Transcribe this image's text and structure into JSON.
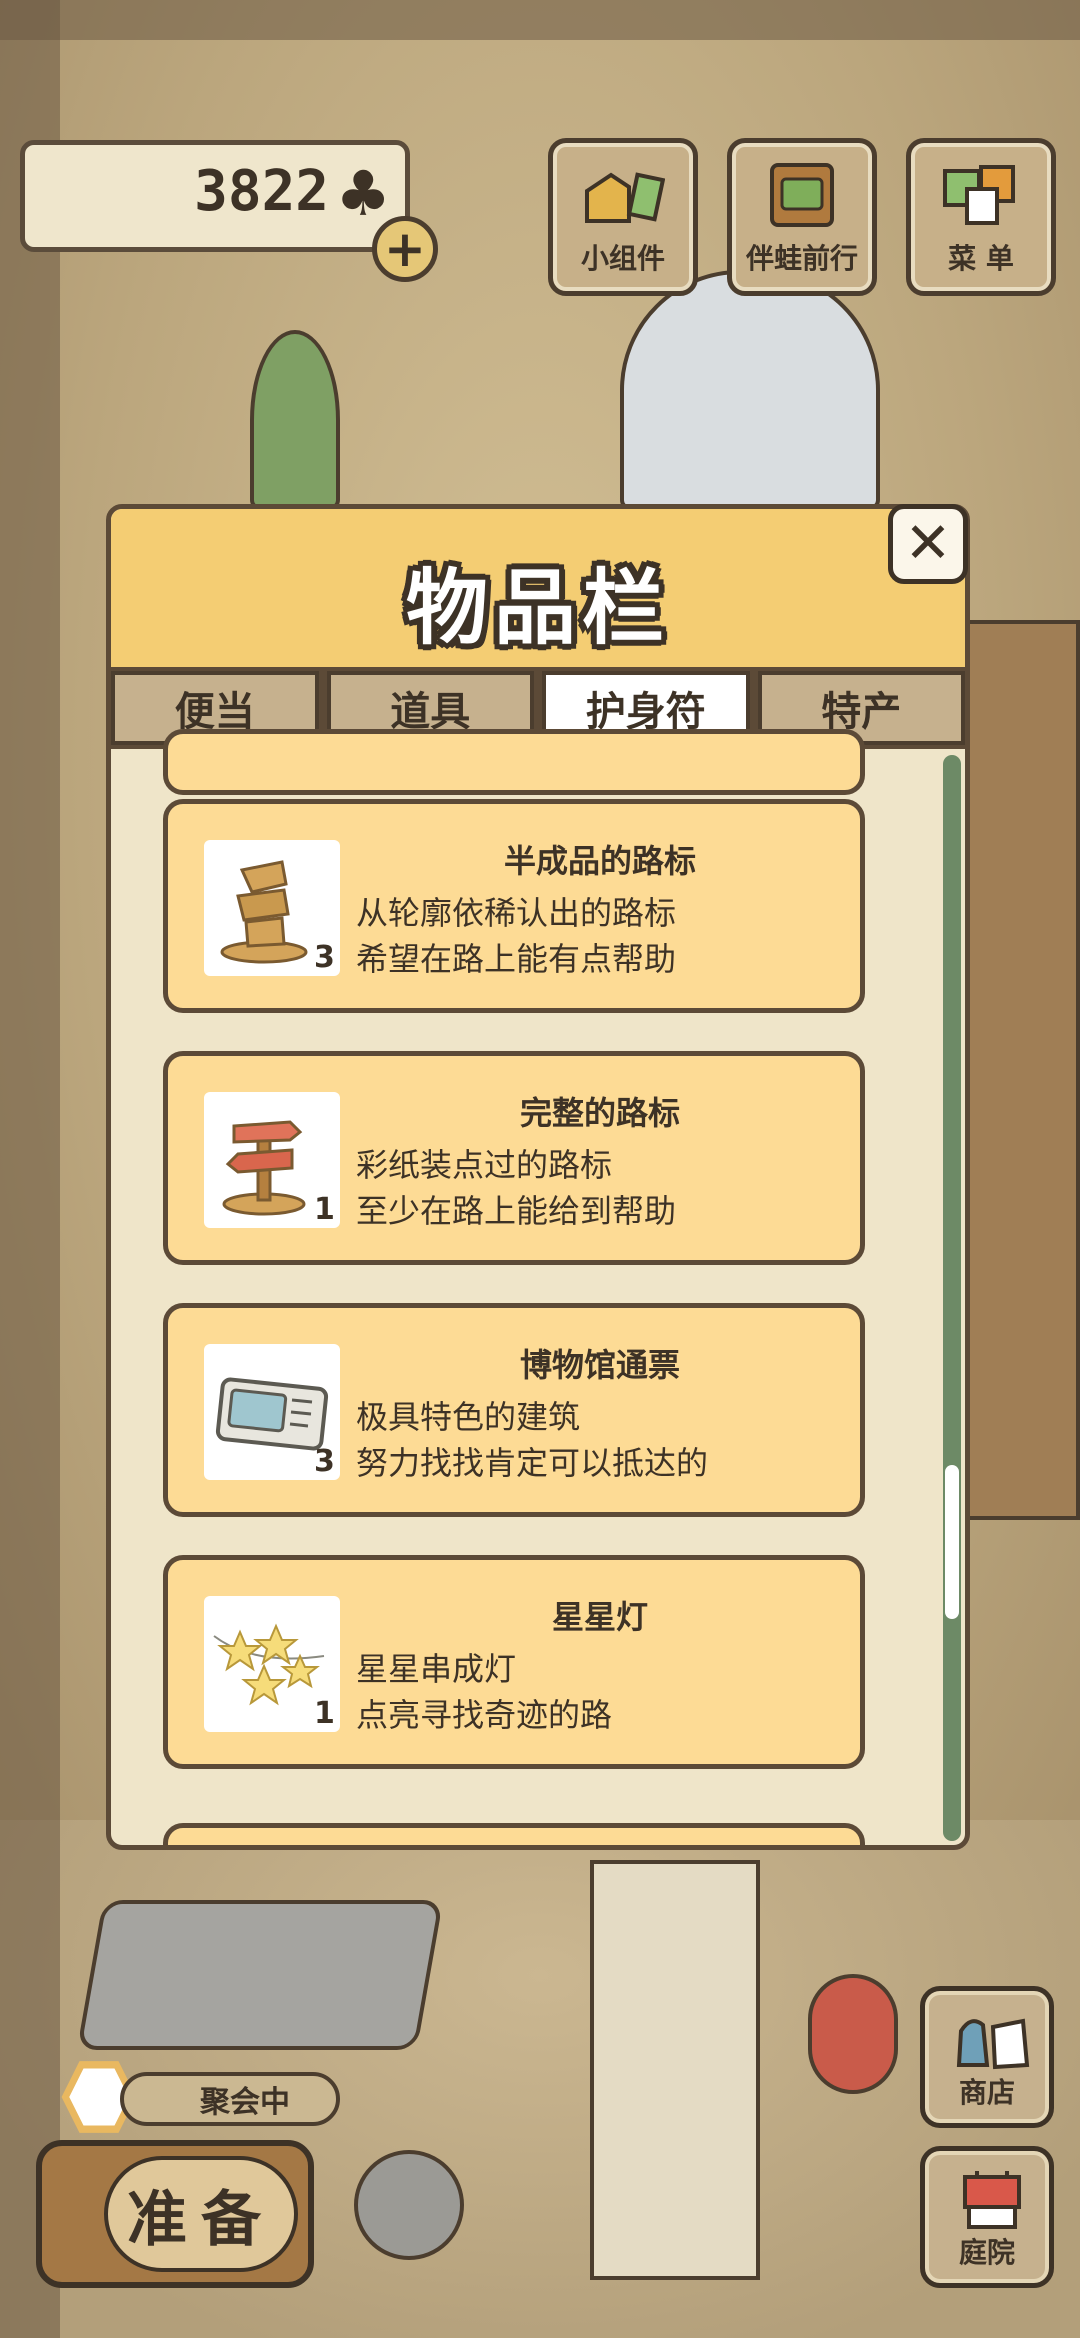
{
  "hud": {
    "clover_count": "3822",
    "add_label": "+",
    "buttons": [
      {
        "label": "小组件",
        "icon": "widget-icon"
      },
      {
        "label": "伴蛙前行",
        "icon": "frog-companion-icon"
      },
      {
        "label": "菜 单",
        "icon": "menu-icon"
      }
    ]
  },
  "inventory": {
    "title": "物品栏",
    "close_label": "✕",
    "tabs": [
      {
        "label": "便当",
        "active": false
      },
      {
        "label": "道具",
        "active": false
      },
      {
        "label": "护身符",
        "active": true
      },
      {
        "label": "特产",
        "active": false
      }
    ],
    "items": [
      {
        "name": "半成品的路标",
        "qty": "3",
        "desc1": "从轮廓依稀认出的路标",
        "desc2": "希望在路上能有点帮助",
        "icon": "half-signpost-icon"
      },
      {
        "name": "完整的路标",
        "qty": "1",
        "desc1": "彩纸装点过的路标",
        "desc2": "至少在路上能给到帮助",
        "icon": "signpost-icon"
      },
      {
        "name": "博物馆通票",
        "qty": "3",
        "desc1": "极具特色的建筑",
        "desc2": "努力找找肯定可以抵达的",
        "icon": "museum-ticket-icon"
      },
      {
        "name": "星星灯",
        "qty": "1",
        "desc1": "星星串成灯",
        "desc2": "点亮寻找奇迹的路",
        "icon": "star-lights-icon"
      }
    ]
  },
  "bottom": {
    "party_label": "聚会中",
    "prepare_label": "准备",
    "side_buttons": [
      {
        "label": "商店",
        "icon": "shop-icon"
      },
      {
        "label": "庭院",
        "icon": "yard-icon"
      }
    ]
  },
  "colors": {
    "panel_header": "#f4cd73",
    "card": "#fddb95",
    "outline": "#5c4a37",
    "scrollbar": "#6d8a66"
  }
}
